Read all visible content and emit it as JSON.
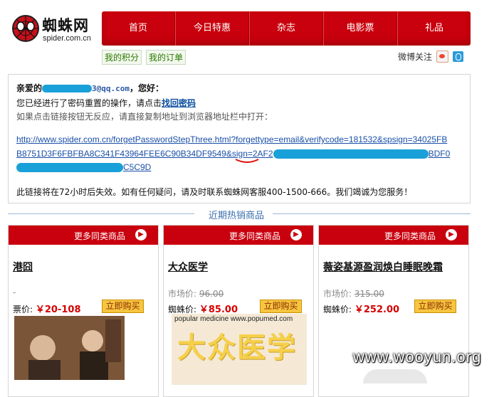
{
  "logo": {
    "name": "蜘蛛网",
    "domain": "spider.com.cn"
  },
  "nav": {
    "items": [
      "首页",
      "今日特惠",
      "杂志",
      "电影票",
      "礼品"
    ]
  },
  "sub_links": [
    "我的积分",
    "我的订单"
  ],
  "weibo": {
    "label": "微博关注",
    "icons": [
      "sina-weibo-icon",
      "qq-weibo-icon"
    ]
  },
  "mail": {
    "greeting_prefix": "亲爱的",
    "email_tail": "3@qq.com",
    "greeting_suffix": "，您好：",
    "reset_text": "您已经进行了密码重置的操作，请点击",
    "reset_link": "找回密码",
    "hint": "如果点击链接按钮无反应，请直接复制地址到浏览器地址栏中打开：",
    "url_part1": "http://www.spider.com.cn/forgetPasswordStepThree.html?forgettype=email&verifycode=181532&spsign=34025FB",
    "url_part2a": "B8751D3F6FBFBA8C341F43964FEE6C90B34DF9549",
    "url_part2b": "&sign=",
    "url_part2c": "2AF2",
    "url_part2d": "BDF0",
    "url_part3": "C5C9D",
    "notice": "此链接将在72小时后失效。如有任何疑问，请及时联系蜘蛛网客服400-1500-666。我们竭诚为您服务！"
  },
  "hot": {
    "title": "近期热销商品"
  },
  "products": [
    {
      "more": "更多同类商品",
      "title": "港囧",
      "market_label": "-",
      "market_price": "",
      "price_label": "票价:",
      "price": "￥20-108",
      "buy": "立即购买"
    },
    {
      "more": "更多同类商品",
      "title": "大众医学",
      "market_label": "市场价:",
      "market_price": "96.00",
      "price_label": "蜘蛛价:",
      "price": "￥85.00",
      "buy": "立即购买",
      "image_text_top": "popular medicine  www.popumed.com",
      "image_title": "大众医学"
    },
    {
      "more": "更多同类商品",
      "title": "薇姿基源盈润焕白睡眠晚霜",
      "market_label": "市场价:",
      "market_price": "315.00",
      "price_label": "蜘蛛价:",
      "price": "￥252.00",
      "buy": "立即购买"
    }
  ],
  "watermark": "www.wooyun.org",
  "colors": {
    "brand_red": "#c9000d",
    "link_blue": "#1a4fa8",
    "mask_blue": "#1aa0d8"
  }
}
